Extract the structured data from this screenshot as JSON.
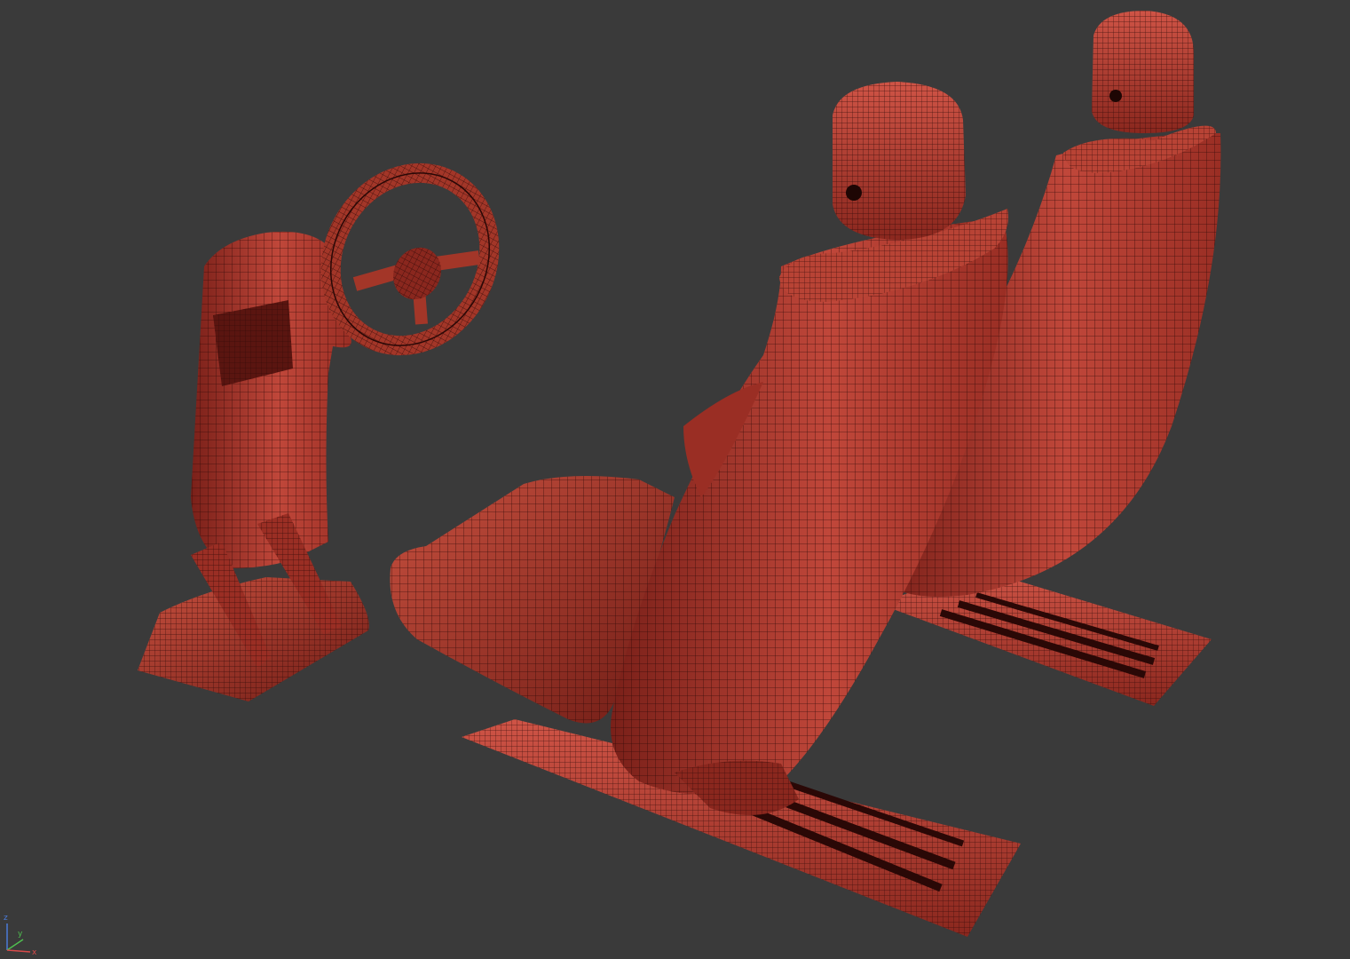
{
  "viewport": {
    "background": "#3a3a3a",
    "render_mode": "wireframe-on-shaded",
    "mesh_color": "#c0473a",
    "mesh_shadow_color": "#7a2019",
    "wire_color": "#2a0806"
  },
  "objects": [
    {
      "name": "steering-column-with-wheel-and-pedals"
    },
    {
      "name": "front-seat-left"
    },
    {
      "name": "front-seat-right"
    }
  ],
  "axis_gizmo": {
    "z_label": "z",
    "y_label": "y",
    "x_label": "x",
    "z_color": "#4a7bd8",
    "y_color": "#4fbf4f",
    "x_color": "#d84a4a"
  }
}
